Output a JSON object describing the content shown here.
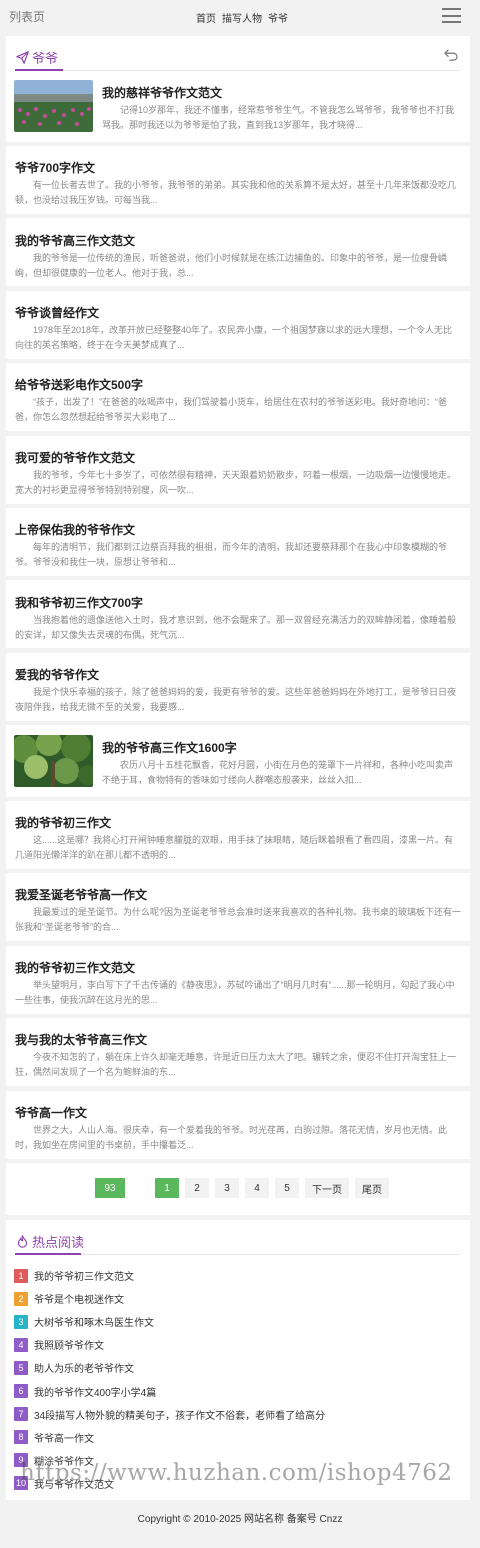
{
  "header": {
    "title": "列表页",
    "nav": [
      "首页",
      "描写人物",
      "爷爷"
    ]
  },
  "section": {
    "title": "爷爷"
  },
  "articles": [
    {
      "title": "我的慈祥爷爷作文范文",
      "summary": "记得10岁那年，我还不懂事，经常惹爷爷生气。不管我怎么骂爷爷，我爷爷也不打我骂我。那时我还以为爷爷是怕了我，直到我13岁那年，我才晓得..."
    },
    {
      "title": "爷爷700字作文",
      "summary": "有一位长者去世了。我的小爷爷，我爷爷的弟弟。其实我和他的关系算不是太好，甚至十几年来饭都没吃几顿，也没给过我压岁钱。可每当我..."
    },
    {
      "title": "我的爷爷高三作文范文",
      "summary": "我的爷爷是一位传统的渔民，听爸爸说，他们小时候就是在练江边捕鱼的。印象中的爷爷，是一位瘦骨嶙峋，但却很健康的一位老人。他对于我，总..."
    },
    {
      "title": "爷爷谈曾经作文",
      "summary": "1978年至2018年，改革开放已经整整40年了。农民奔小康，一个祖国梦寐以求的远大理想，一个令人无比向往的英名策略，终于在今天美梦成真了..."
    },
    {
      "title": "给爷爷送彩电作文500字",
      "summary": "“孩子，出发了！”在爸爸的吆喝声中，我们驾驶着小货车，给居住在农村的爷爷送彩电。我好奇地问：“爸爸，你怎么忽然想起给爷爷买大彩电了..."
    },
    {
      "title": "我可爱的爷爷作文范文",
      "summary": "我的爷爷，今年七十多岁了，可依然很有精神，天天跟着奶奶散步，叼着一根烟，一边吸烟一边慢慢地走。宽大的衬衫更显得爷爷特别特别瘦，风一吹..."
    },
    {
      "title": "上帝保佑我的爷爷作文",
      "summary": "每年的清明节，我们都到江边祭百拜我的祖祖，而今年的清明，我却还要祭拜那个在我心中印象模糊的爷爷。爷爷没和我住一块，原想让爷爷和..."
    },
    {
      "title": "我和爷爷初三作文700字",
      "summary": "当我抱着他的遗像送他入土时，我才意识到，他不会醒来了。那一双曾经充满活力的双眸静闭着，像睡着般的安详，却又像失去灵魂的布偶，死气沉..."
    },
    {
      "title": "爱我的爷爷作文",
      "summary": "我是个快乐幸福的孩子，除了爸爸妈妈的爱，我更有爷爷的爱。这些年爸爸妈妈在外地打工，是爷爷日日夜夜陪伴我，给我无微不至的关爱，我要感..."
    },
    {
      "title": "我的爷爷高三作文1600字",
      "summary": "农历八月十五桂花飘香，花好月圆，小街在月色的笼罩下一片祥和，各种小吃叫卖声不绝于耳，食物特有的香味如寸缕向人群嘲态般袭来，丝丝入扣..."
    },
    {
      "title": "我的爷爷初三作文",
      "summary": "这......这是哪？我将心打开闸钟睡意朦胧的双眼，用手抹了抹眼睛，随后眯着眼看了看四周，漆黑一片。有几道阳光懒洋洋的趴在那儿都不透明的..."
    },
    {
      "title": "我爱圣诞老爷爷高一作文",
      "summary": "我最爱过的是圣诞节。为什么呢?因为圣诞老爷爷总会准时送来我喜欢的各种礼物。我书桌的玻璃板下还有一张我和“圣诞老爷爷”的合..."
    },
    {
      "title": "我的爷爷初三作文范文",
      "summary": "举头望明月，李白写下了千古传诵的《静夜思》，苏轼吟诵出了“明月几时有”......那一轮明月，勾起了我心中一些往事，使我沉醉在这月光的思..."
    },
    {
      "title": "我与我的太爷爷高三作文",
      "summary": "今夜不知怎的了，躺在床上许久却毫无睡意，许是近日压力太大了吧。辗转之余，便忍不住打开淘宝狂上一狂，偶然间发现了一个名为鲍鲜油的东..."
    },
    {
      "title": "爷爷高一作文",
      "summary": "世界之大，人山人海。很庆幸，有一个爱着我的爷爷。时光荏苒，白驹过隙。落花无情，岁月也无情。此时，我如坐在房间里的书桌前，手中攥着泛..."
    }
  ],
  "pagination": {
    "total": "93",
    "pages": [
      "1",
      "2",
      "3",
      "4",
      "5"
    ],
    "next": "下一页",
    "last": "尾页",
    "current": "1"
  },
  "hot": {
    "title": "热点阅读",
    "items": [
      "我的爷爷初三作文范文",
      "爷爷是个电视迷作文",
      "大树爷爷和啄木鸟医生作文",
      "我照顾爷爷作文",
      "助人为乐的老爷爷作文",
      "我的爷爷作文400字小学4篇",
      "34段描写人物外貌的精美句子，孩子作文不俗套，老师看了给高分",
      "爷爷高一作文",
      "糊涂爷爷作文",
      "我与爷爷作文范文"
    ],
    "badge_colors": [
      "#e05b5b",
      "#f0a030",
      "#26b5c8",
      "#8e5bc7",
      "#8e5bc7",
      "#8e5bc7",
      "#8e5bc7",
      "#8e5bc7",
      "#8e5bc7",
      "#8e5bc7"
    ]
  },
  "footer": {
    "text": "Copyright © 2010-2025 网站名称 备案号 Cnzz"
  },
  "watermark": "https://www.huzhan.com/ishop4762",
  "colors": {
    "accent": "#8e44ad",
    "pager_active": "#5cb85c"
  }
}
